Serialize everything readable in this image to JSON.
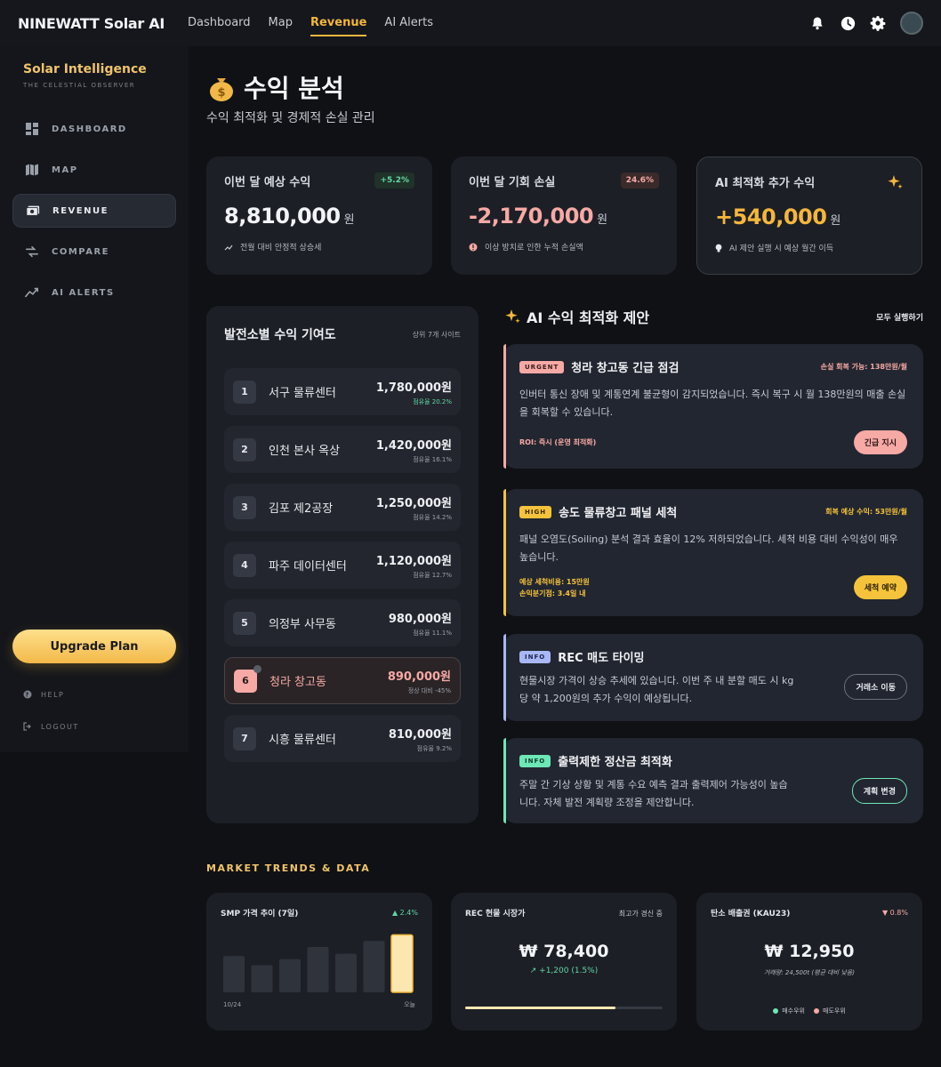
{
  "topbar": {
    "brand": "NINEWATT Solar AI",
    "nav": [
      {
        "label": "Dashboard"
      },
      {
        "label": "Map"
      },
      {
        "label": "Revenue"
      },
      {
        "label": "AI Alerts"
      }
    ],
    "icons": [
      "bell-icon",
      "clock-icon",
      "gear-icon",
      "avatar"
    ]
  },
  "sidebar": {
    "title": "Solar Intelligence",
    "subtitle": "THE CELESTIAL OBSERVER",
    "items": [
      {
        "label": "DASHBOARD",
        "icon": "dashboard-icon"
      },
      {
        "label": "MAP",
        "icon": "map-icon"
      },
      {
        "label": "REVENUE",
        "icon": "revenue-icon"
      },
      {
        "label": "COMPARE",
        "icon": "compare-icon"
      },
      {
        "label": "AI ALERTS",
        "icon": "trend-icon"
      }
    ],
    "upgrade": "Upgrade Plan",
    "help": "HELP",
    "logout": "LOGOUT"
  },
  "page": {
    "title": "수익 분석",
    "subtitle": "수익 최적화 및 경제적 손실 관리"
  },
  "kpis": [
    {
      "title": "이번 달 예상 수익",
      "badge": "+5.2%",
      "value": "8,810,000",
      "unit": "원",
      "note": "전월 대비 안정적 상승세"
    },
    {
      "title": "이번 달 기회 손실",
      "badge": "24.6%",
      "value": "-2,170,000",
      "unit": "원",
      "note": "이상 방치로 인한 누적 손실액"
    },
    {
      "title": "AI 최적화 추가 수익",
      "badge": "",
      "value": "+540,000",
      "unit": "원",
      "note": "AI 제안 실행 시 예상 월간 이득"
    }
  ],
  "contribution": {
    "title": "발전소별 수익 기여도",
    "meta": "상위 7개 사이트",
    "rows": [
      {
        "rank": "1",
        "name": "서구 물류센터",
        "amount": "1,780,000원",
        "sub": "점유율 20.2%"
      },
      {
        "rank": "2",
        "name": "인천 본사 옥상",
        "amount": "1,420,000원",
        "sub": "점유율 16.1%"
      },
      {
        "rank": "3",
        "name": "김포 제2공장",
        "amount": "1,250,000원",
        "sub": "점유율 14.2%"
      },
      {
        "rank": "4",
        "name": "파주 데이터센터",
        "amount": "1,120,000원",
        "sub": "점유율 12.7%"
      },
      {
        "rank": "5",
        "name": "의정부 사무동",
        "amount": "980,000원",
        "sub": "점유율 11.1%"
      },
      {
        "rank": "6",
        "name": "청라 창고동",
        "amount": "890,000원",
        "sub": "정상 대비 -45%"
      },
      {
        "rank": "7",
        "name": "시흥 물류센터",
        "amount": "810,000원",
        "sub": "점유율 9.2%"
      }
    ]
  },
  "ai": {
    "title": "AI 수익 최적화 제안",
    "run_all": "모두 실행하기",
    "suggestions": [
      {
        "tag": "URGENT",
        "title": "청라 창고동 긴급 점검",
        "right": "손실 회복 가능: 138만원/월",
        "body": "인버터 통신 장애 및 계통연계 불균형이 감지되었습니다. 즉시 복구 시 월 138만원의 매출 손실을 회복할 수 있습니다.",
        "foot": "ROI: 즉시 (운영 최적화)",
        "button": "긴급 지시"
      },
      {
        "tag": "HIGH",
        "title": "송도 물류창고 패널 세척",
        "right": "회복 예상 수익: 53만원/월",
        "body": "패널 오염도(Soiling) 분석 결과 효율이 12% 저하되었습니다. 세척 비용 대비 수익성이 매우 높습니다.",
        "foot1": "예상 세척비용: 15만원",
        "foot2": "손익분기점: 3.4일 내",
        "button": "세척 예약"
      },
      {
        "tag": "INFO",
        "title": "REC 매도 타이밍",
        "body": "현물시장 가격이 상승 추세에 있습니다. 이번 주 내 분할 매도 시 kg당 약 1,200원의 추가 수익이 예상됩니다.",
        "button": "거래소 이동"
      },
      {
        "tag": "INFO",
        "title": "출력제한 정산금 최적화",
        "body": "주말 간 기상 상황 및 계통 수요 예측 결과 출력제어 가능성이 높습니다. 자체 발전 계획량 조정을 제안합니다.",
        "button": "계획 변경"
      }
    ]
  },
  "market": {
    "label": "MARKET TRENDS & DATA",
    "smp": {
      "title": "SMP 가격 추이 (7일)",
      "change": "▲ 2.4%",
      "start": "10/24",
      "end": "오늘"
    },
    "rec": {
      "title": "REC 현물 시장가",
      "status": "최고가 경신 중",
      "value": "₩ 78,400",
      "change": "↗ +1,200 (1.5%)",
      "progress": 0.76
    },
    "carbon": {
      "title": "탄소 배출권 (KAU23)",
      "change": "▼ 0.8%",
      "value": "₩ 12,950",
      "sub": "거래량: 24,500t (평균 대비 낮음)",
      "legend": [
        "매수우위",
        "매도우위"
      ]
    }
  },
  "chart_data": {
    "type": "bar",
    "categories": [
      "10/24",
      "",
      "",
      "",
      "",
      "",
      "오늘"
    ],
    "values": [
      48,
      36,
      44,
      60,
      51,
      68,
      76
    ],
    "title": "SMP 가격 추이 (7일)",
    "xlabel": "",
    "ylabel": "",
    "ylim": [
      0,
      80
    ]
  },
  "colors": {
    "accent": "#f4b73b",
    "urgent": "#f7a9a5",
    "high": "#f5c33b",
    "info_blue": "#a9b8f5",
    "info_green": "#6ee7b7",
    "positive": "#62d6a3"
  }
}
